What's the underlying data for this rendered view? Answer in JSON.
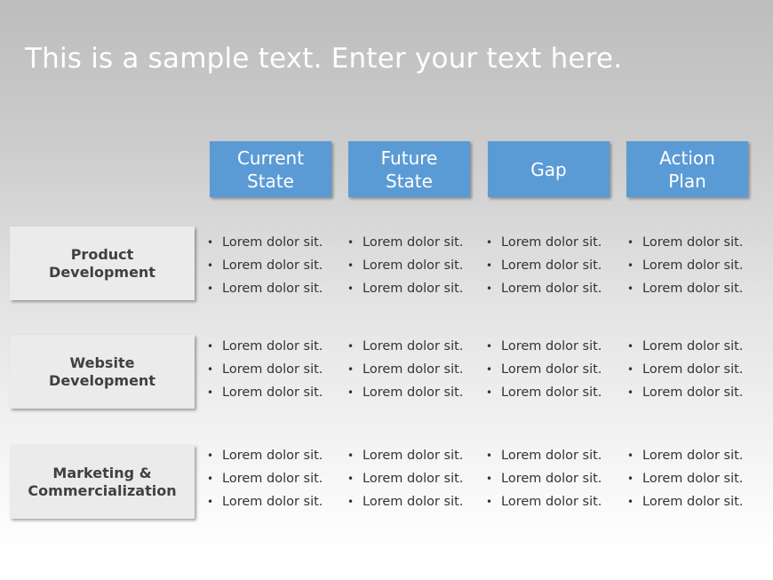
{
  "title": "This is a sample text. Enter your text here.",
  "columns": [
    {
      "label": "Current\nState"
    },
    {
      "label": "Future\nState"
    },
    {
      "label": "Gap"
    },
    {
      "label": "Action\nPlan"
    }
  ],
  "rows": [
    {
      "label": "Product\nDevelopment",
      "cells": [
        [
          "Lorem dolor sit.",
          "Lorem dolor sit.",
          "Lorem dolor sit."
        ],
        [
          "Lorem dolor sit.",
          "Lorem dolor sit.",
          "Lorem dolor sit."
        ],
        [
          "Lorem dolor sit.",
          "Lorem dolor sit.",
          "Lorem dolor sit."
        ],
        [
          "Lorem dolor sit.",
          "Lorem dolor sit.",
          "Lorem dolor sit."
        ]
      ]
    },
    {
      "label": "Website\nDevelopment",
      "cells": [
        [
          "Lorem dolor sit.",
          "Lorem dolor sit.",
          "Lorem dolor sit."
        ],
        [
          "Lorem dolor sit.",
          "Lorem dolor sit.",
          "Lorem dolor sit."
        ],
        [
          "Lorem dolor sit.",
          "Lorem dolor sit.",
          "Lorem dolor sit."
        ],
        [
          "Lorem dolor sit.",
          "Lorem dolor sit.",
          "Lorem dolor sit."
        ]
      ]
    },
    {
      "label": "Marketing &\nCommercialization",
      "cells": [
        [
          "Lorem dolor sit.",
          "Lorem dolor sit.",
          "Lorem dolor sit."
        ],
        [
          "Lorem dolor sit.",
          "Lorem dolor sit.",
          "Lorem dolor sit."
        ],
        [
          "Lorem dolor sit.",
          "Lorem dolor sit.",
          "Lorem dolor sit."
        ],
        [
          "Lorem dolor sit.",
          "Lorem dolor sit.",
          "Lorem dolor sit."
        ]
      ]
    }
  ],
  "bullet_glyph": "•",
  "colors": {
    "header_fill": "#5b9bd5",
    "row_label_fill": "#ebebeb",
    "row_label_text": "#404040",
    "body_text": "#333333"
  }
}
